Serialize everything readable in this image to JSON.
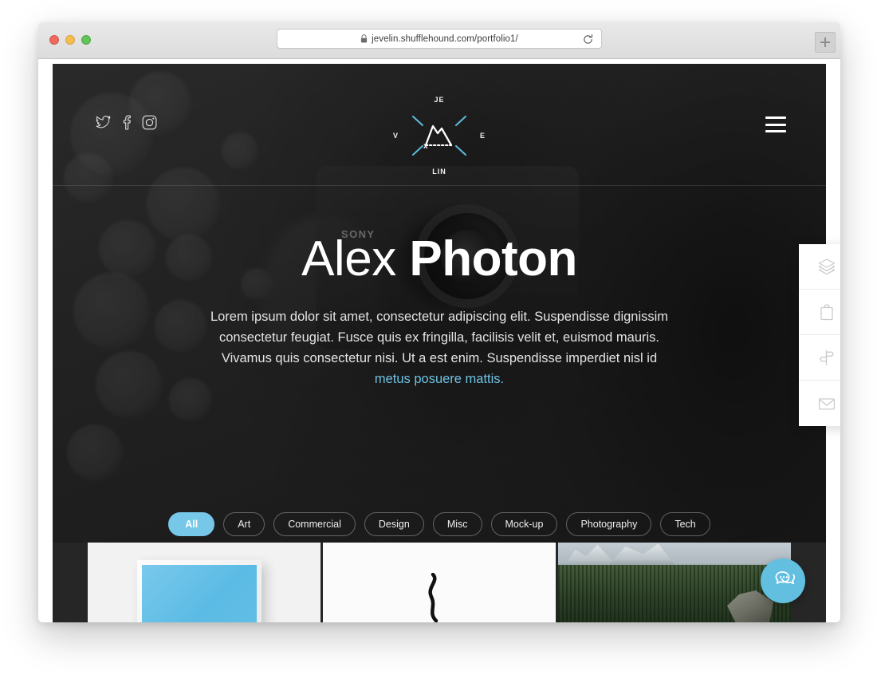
{
  "browser": {
    "url": "jevelin.shufflehound.com/portfolio1/",
    "lock_icon": "lock-icon",
    "reload_icon": "reload-icon",
    "new_tab_icon": "plus-icon",
    "traffic_lights": [
      "close-red",
      "minimize-yellow",
      "zoom-green"
    ]
  },
  "site": {
    "logo": {
      "top": "JE",
      "left": "V",
      "right": "E",
      "bottom": "LIN",
      "icon": "mountain-peak-logo-icon"
    },
    "social": [
      {
        "name": "twitter-icon",
        "label": "Twitter"
      },
      {
        "name": "facebook-icon",
        "label": "Facebook"
      },
      {
        "name": "instagram-icon",
        "label": "Instagram"
      }
    ],
    "menu_toggle": "hamburger-menu-icon"
  },
  "hero": {
    "title_light": "Alex ",
    "title_bold": "Photon",
    "paragraph_before": "Lorem ipsum dolor sit amet, consectetur adipiscing elit. Suspendisse dignissim consectetur feugiat. Fusce quis ex fringilla, facilisis velit et, euismod mauris. Vivamus quis consectetur nisi. Ut a est enim. Suspendisse imperdiet nisl id ",
    "link_text": "metus posuere mattis."
  },
  "filters": [
    {
      "label": "All",
      "active": true
    },
    {
      "label": "Art",
      "active": false
    },
    {
      "label": "Commercial",
      "active": false
    },
    {
      "label": "Design",
      "active": false
    },
    {
      "label": "Misc",
      "active": false
    },
    {
      "label": "Mock-up",
      "active": false
    },
    {
      "label": "Photography",
      "active": false
    },
    {
      "label": "Tech",
      "active": false
    }
  ],
  "portfolio_items": [
    {
      "name": "portfolio-thumb-framed-blue-artwork"
    },
    {
      "name": "portfolio-thumb-white-object"
    },
    {
      "name": "portfolio-thumb-mountain-forest"
    }
  ],
  "side_dock": [
    {
      "icon": "layers-icon",
      "label": "Layers"
    },
    {
      "icon": "briefcase-icon",
      "label": "Portfolio"
    },
    {
      "icon": "signpost-icon",
      "label": "Directions"
    },
    {
      "icon": "envelope-icon",
      "label": "Contact"
    }
  ],
  "chat": {
    "icon": "chat-bubbles-icon",
    "label": "Chat"
  },
  "colors": {
    "accent": "#76c7e8",
    "link": "#6ec2e3",
    "hero_bg": "#2b2b2b",
    "dock_bg": "#ffffff"
  }
}
